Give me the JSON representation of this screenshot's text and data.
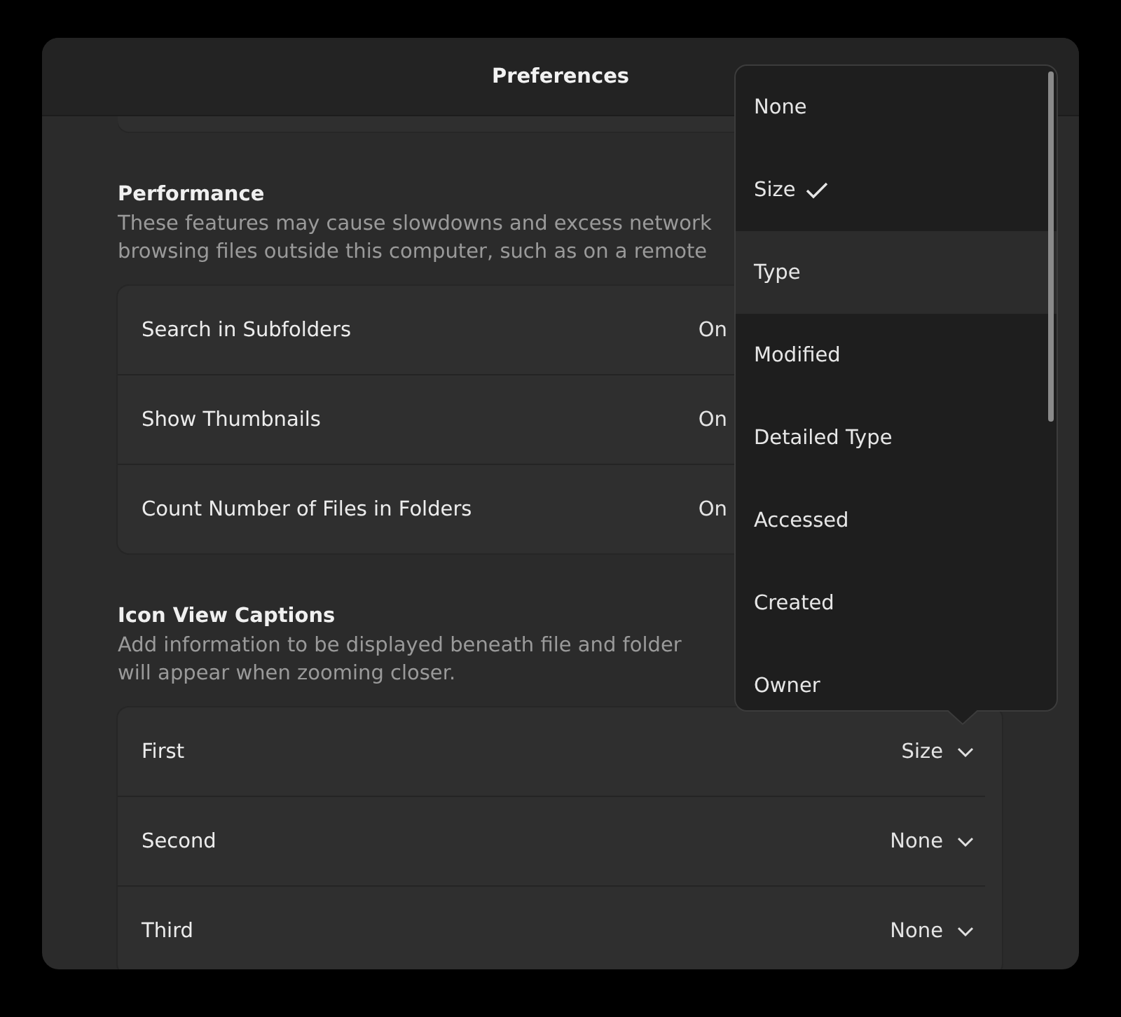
{
  "window": {
    "title": "Preferences"
  },
  "sections": [
    {
      "heading": "Performance",
      "description": "These features may cause slowdowns and excess network\nbrowsing files outside this computer, such as on a remote",
      "rows": [
        {
          "kind": "setting",
          "label": "Search in Subfolders",
          "value": "On"
        },
        {
          "kind": "setting",
          "label": "Show Thumbnails",
          "value": "On"
        },
        {
          "kind": "setting",
          "label": "Count Number of Files in Folders",
          "value": "On"
        }
      ]
    },
    {
      "heading": "Icon View Captions",
      "description": "Add information to be displayed beneath file and folder\nwill appear when zooming closer.",
      "rows": [
        {
          "kind": "dropdown",
          "label": "First",
          "value": "Size"
        },
        {
          "kind": "dropdown",
          "label": "Second",
          "value": "None"
        },
        {
          "kind": "dropdown",
          "label": "Third",
          "value": "None"
        }
      ]
    }
  ],
  "popup": {
    "items": [
      {
        "label": "None",
        "selected": false,
        "hovered": false
      },
      {
        "label": "Size",
        "selected": true,
        "hovered": false
      },
      {
        "label": "Type",
        "selected": false,
        "hovered": true
      },
      {
        "label": "Modified",
        "selected": false,
        "hovered": false
      },
      {
        "label": "Detailed Type",
        "selected": false,
        "hovered": false
      },
      {
        "label": "Accessed",
        "selected": false,
        "hovered": false
      },
      {
        "label": "Created",
        "selected": false,
        "hovered": false
      },
      {
        "label": "Owner",
        "selected": false,
        "hovered": false
      }
    ]
  }
}
